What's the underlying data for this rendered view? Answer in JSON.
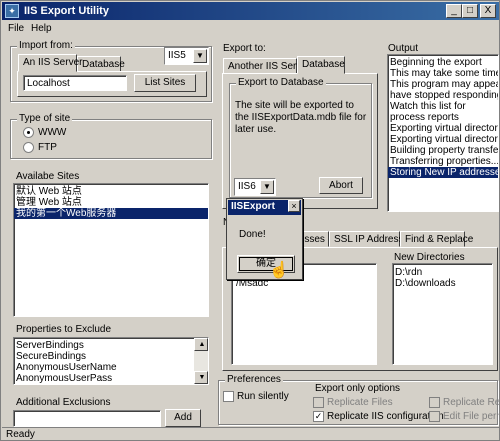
{
  "window": {
    "title": "IIS Export Utility",
    "minimize": "_",
    "maximize": "□",
    "close": "X"
  },
  "menu": {
    "file": "File",
    "help": "Help"
  },
  "import_from": {
    "label": "Import from:",
    "tabs": [
      "An IIS Server",
      "Database"
    ],
    "version": "IIS5",
    "server": "Localhost",
    "list_sites_label": "List Sites"
  },
  "type_of_site": {
    "label": "Type of site",
    "options": [
      "WWW",
      "FTP"
    ],
    "selected": "WWW"
  },
  "available_sites": {
    "label": "Availabe Sites",
    "items": [
      "默认 Web 站点",
      "管理 Web 站点",
      "我的第一个Web服务器"
    ],
    "selected_index": 2
  },
  "properties_to_exclude": {
    "label": "Properties to Exclude",
    "items": [
      "ServerBindings",
      "SecureBindings",
      "AnonymousUserName",
      "AnonymousUserPass"
    ]
  },
  "additional_exclusions": {
    "label": "Additional Exclusions",
    "value": "",
    "add_label": "Add"
  },
  "export_to": {
    "label": "Export to:",
    "tabs": [
      "Another IIS Server",
      "Database"
    ],
    "active_tab": "Database",
    "group_label": "Export to Database",
    "message": "The site will be exported to the IISExportData.mdb file for later use.",
    "version": "IIS6",
    "abort_label": "Abort"
  },
  "output": {
    "label": "Output",
    "items": [
      "Beginning the export",
      "This may take some time",
      "This program may appear to",
      "have stopped responding",
      "Watch this list for",
      "process reports",
      "Exporting virtual directory /Ro",
      "Exporting virtual directory /Ro",
      "Building property transfer list",
      "Transferring properties...",
      "Storing New IP addresses"
    ],
    "selected_index": 10
  },
  "mapping": {
    "label_partial": "N",
    "tabs": [
      "...sses",
      "SSL IP Addresses",
      "Find & Replace"
    ],
    "left_item": "/Msadc",
    "new_directories_label": "New Directories",
    "new_directories": [
      "D:\\rdn",
      "D:\\downloads"
    ]
  },
  "preferences": {
    "label": "Preferences",
    "run_silently": "Run silently",
    "export_only_label": "Export only options",
    "replicate_files": "Replicate Files",
    "replicate_iis": "Replicate IIS configuration",
    "replicate_reference": "Replicate Refe",
    "edit_file_perms": "Edit File perms"
  },
  "dialog": {
    "title": "IISExport",
    "message": "Done!",
    "ok_label": "确定"
  },
  "status": {
    "text": "Ready"
  }
}
